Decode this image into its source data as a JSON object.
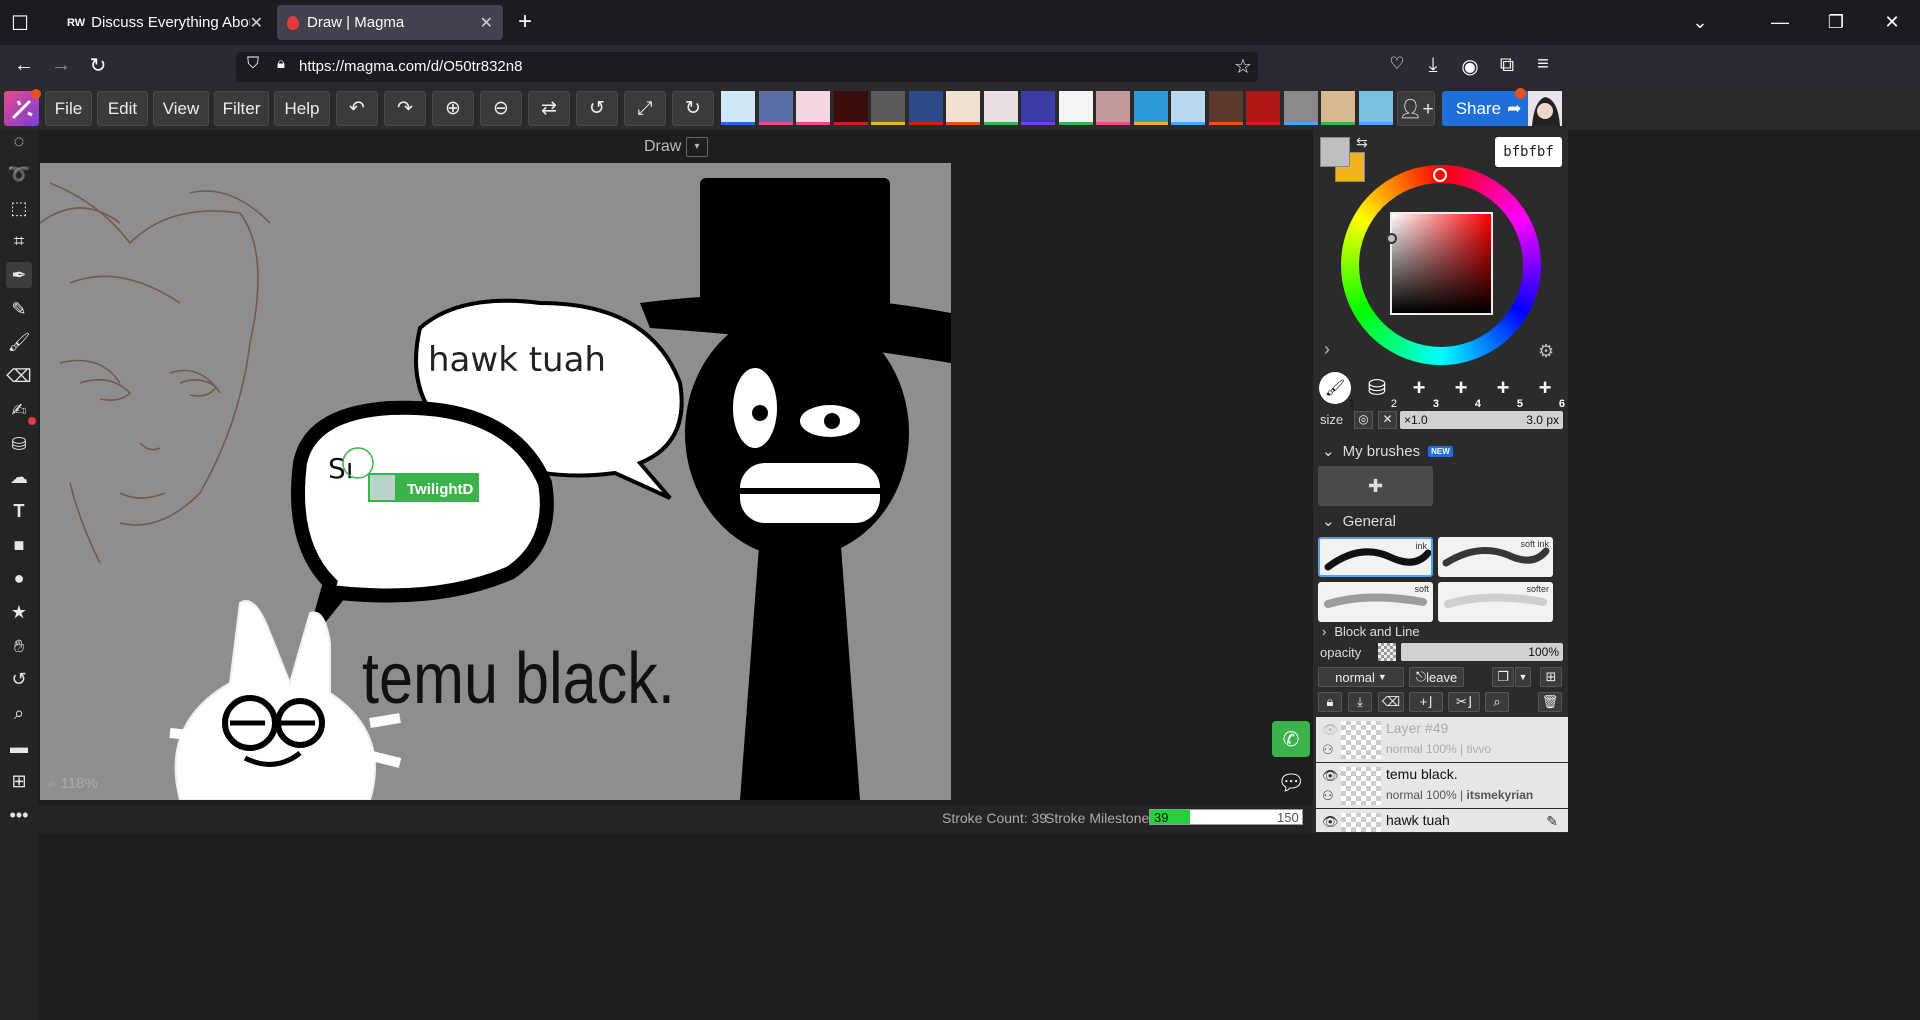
{
  "browser": {
    "tabs": [
      {
        "favicon": "RW",
        "title": "Discuss Everything About Roblo",
        "active": false
      },
      {
        "favicon": "magma-icon",
        "title": "Draw | Magma",
        "active": true
      }
    ],
    "url": "https://magma.com/d/O50tr832n8"
  },
  "menu": {
    "file": "File",
    "edit": "Edit",
    "view": "View",
    "filter": "Filter",
    "help": "Help"
  },
  "toolbar_icons": [
    "undo-icon",
    "redo-icon",
    "zoom-in-icon",
    "zoom-out-icon",
    "swap-icon",
    "rotate-left-icon",
    "fullscreen-icon",
    "rotate-right-icon"
  ],
  "share": {
    "label": "Share"
  },
  "canvas": {
    "mode_label": "Draw",
    "zoom": "118%",
    "speech_text": "hawk tuah",
    "caption_text": "temu black.",
    "scribble_text": "Sı",
    "cursor_user": "TwilightD"
  },
  "status": {
    "stroke_count": "Stroke Count: 39",
    "milestone_label": "Stroke Milestone:",
    "milestone_value": "39",
    "milestone_max": "150",
    "milestone_progress": 0.26
  },
  "color": {
    "hex": "bfbfbf",
    "primary": "#bfbfbf",
    "secondary": "#f0b31e"
  },
  "brush": {
    "slots": [
      "1",
      "2",
      "3",
      "4",
      "5",
      "6"
    ],
    "size_label": "size",
    "size_multiplier": "×1.0",
    "size_value": "3.0 px",
    "my_brushes": "My brushes",
    "new_badge": "NEW",
    "general": "General",
    "presets": [
      "ink",
      "soft ink",
      "soft",
      "softer"
    ],
    "next_section": "Block and Line"
  },
  "layers": {
    "opacity_label": "opacity",
    "opacity_value": "100%",
    "blend_mode": "normal",
    "leave_label": "leave",
    "items": [
      {
        "name": "Layer #49",
        "meta": "normal 100% | ",
        "owner": "tivvo"
      },
      {
        "name": "temu black.",
        "meta": "normal 100% | ",
        "owner": "itsmekyrian"
      },
      {
        "name": "hawk tuah",
        "meta": "",
        "owner": ""
      }
    ]
  }
}
